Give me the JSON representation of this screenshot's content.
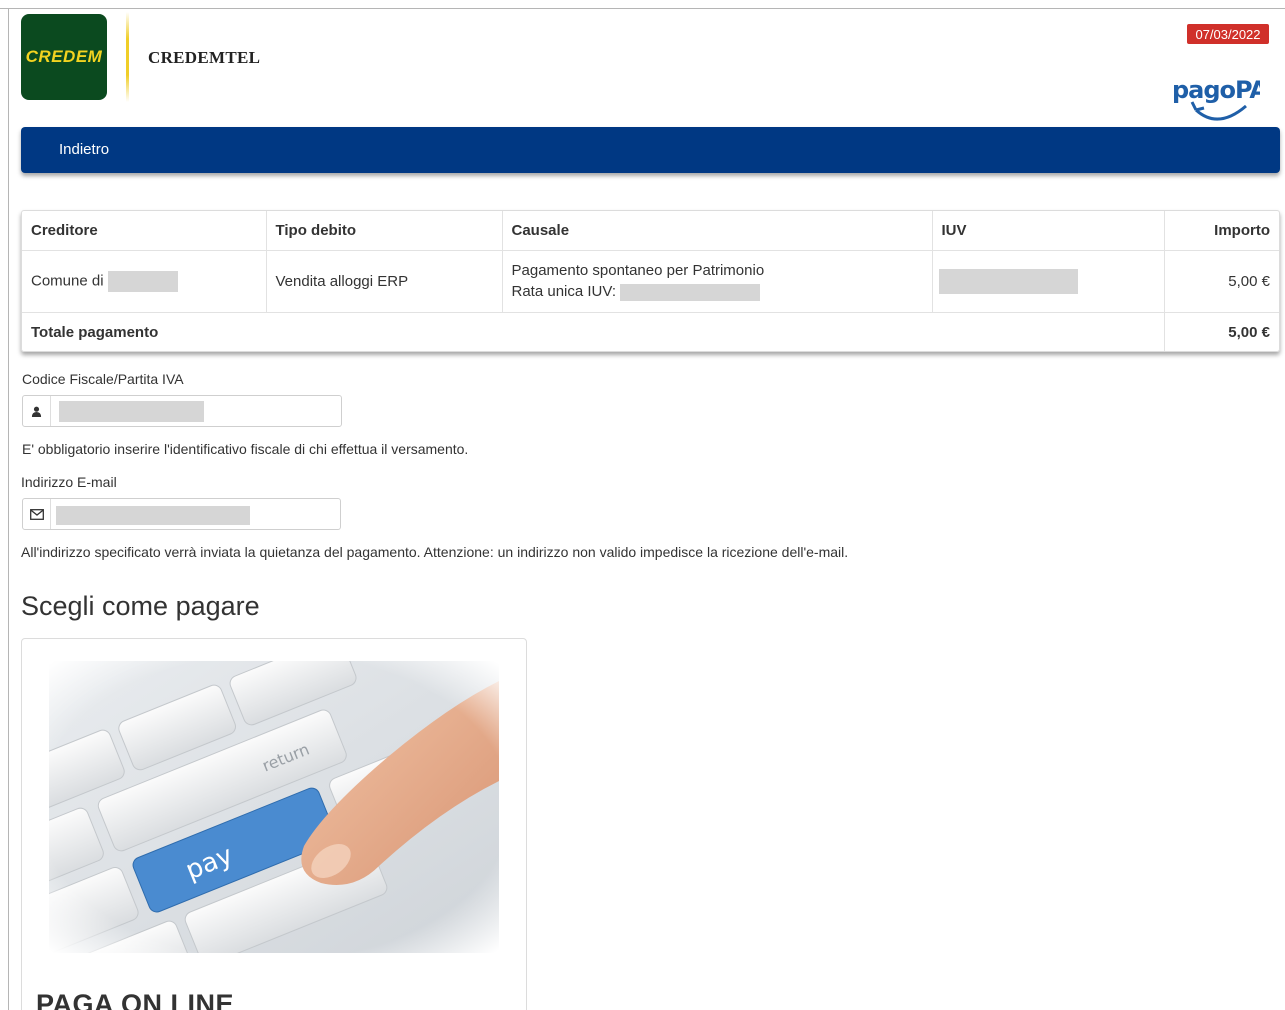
{
  "header": {
    "brand_logo_text": "CREDEM",
    "app_title": "CREDEMTEL",
    "date": "07/03/2022",
    "pagopa_text": "pagoPA"
  },
  "nav": {
    "back_label": "Indietro"
  },
  "table": {
    "headers": [
      "Creditore",
      "Tipo debito",
      "Causale",
      "IUV",
      "Importo"
    ],
    "row": {
      "creditore": "Comune di",
      "tipo_debito": "Vendita alloggi ERP",
      "causale_line1": "Pagamento spontaneo per Patrimonio",
      "causale_line2": "Rata unica IUV:",
      "importo": "5,00 €"
    },
    "total_label": "Totale pagamento",
    "total_value": "5,00 €"
  },
  "form": {
    "cf_label": "Codice Fiscale/Partita IVA",
    "cf_help": "E' obbligatorio inserire l'identificativo fiscale di chi effettua il versamento.",
    "email_label": "Indirizzo E-mail",
    "email_help": "All'indirizzo specificato verrà inviata la quietanza del pagamento. Attenzione: un indirizzo non valido impedisce la ricezione dell'e-mail.",
    "cf_icon": "user-icon",
    "email_icon": "envelope-icon"
  },
  "payment": {
    "section_title": "Scegli come pagare",
    "card_title": "PAGA ON LINE",
    "key_pay_label": "pay",
    "key_return_label": "return"
  },
  "colors": {
    "navbar": "#003883",
    "date_badge": "#d0302a",
    "logo_bg": "#0b4a1f",
    "logo_text": "#f3d320",
    "pagopa_blue": "#1f5fa8",
    "pay_key": "#4a8bd0"
  }
}
